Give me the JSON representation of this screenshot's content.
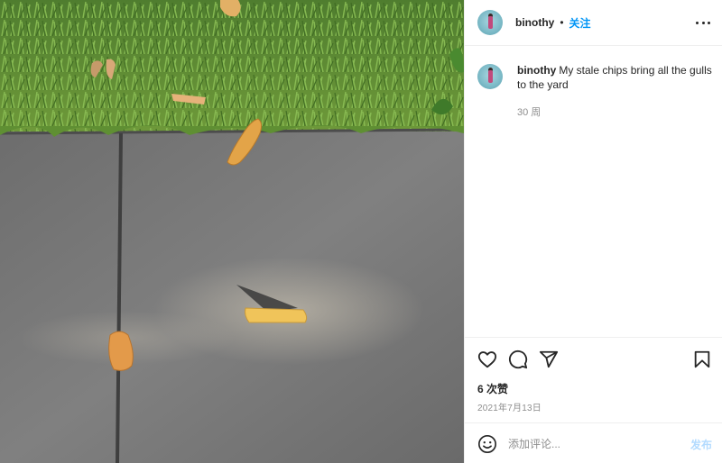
{
  "photo": {
    "alt": ""
  },
  "header": {
    "username": "binothy",
    "separator": "•",
    "follow_label": "关注"
  },
  "caption": {
    "username": "binothy",
    "text": "My stale chips bring all the gulls to the yard",
    "time": "30 周"
  },
  "actions": {
    "icons": [
      "heart-icon",
      "comment-icon",
      "share-icon",
      "bookmark-icon"
    ]
  },
  "likes": "6 次赞",
  "date": "2021年7月13日",
  "comment_box": {
    "placeholder": "添加评论...",
    "post_label": "发布"
  },
  "colors": {
    "accent": "#0095f6",
    "post_disabled": "#b3dbff",
    "muted": "#8e8e8e",
    "text": "#262626"
  }
}
